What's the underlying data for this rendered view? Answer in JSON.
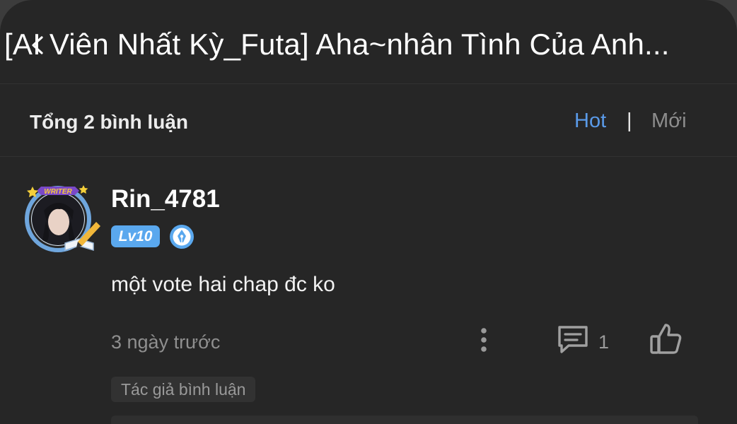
{
  "header": {
    "title": "[AI Viên Nhất Kỳ_Futa] Aha~nhân Tình Của Anh..."
  },
  "comments_header": {
    "count_label": "Tổng 2 bình luận",
    "sort_hot": "Hot",
    "separator": "|",
    "sort_new": "Mới"
  },
  "comment": {
    "avatar_badge": "WRITER",
    "username": "Rin_4781",
    "level": "Lv10",
    "text": "một vote hai chap đc ko",
    "time": "3 ngày trước",
    "reply_count": "1",
    "tag": "Tác giả bình luận"
  },
  "colors": {
    "background": "#262626",
    "accent": "#5a9ae8",
    "level_badge": "#5aa8ee"
  }
}
